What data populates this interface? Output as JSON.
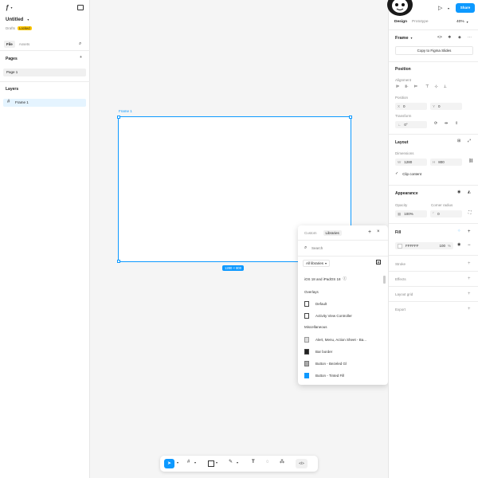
{
  "app": {
    "file_name": "Untitled",
    "team": "Drafts",
    "locked_badge": "Locked"
  },
  "left": {
    "tabs": [
      "File",
      "Assets"
    ],
    "pages_title": "Pages",
    "pages": [
      "Page 1"
    ],
    "layers_title": "Layers",
    "layers": [
      "Frame 1"
    ]
  },
  "canvas": {
    "frame_label": "Frame 1",
    "size_badge": "1280 × 800"
  },
  "library_popup": {
    "tabs": [
      "Custom",
      "Libraries"
    ],
    "search_placeholder": "Search",
    "filter_label": "All libraries",
    "group_title": "iOS 18 and iPadOS 18",
    "sections": [
      {
        "title": "Overlays",
        "items": [
          "Default",
          "Activity View Controller"
        ]
      },
      {
        "title": "Miscellaneous",
        "items": [
          "Alert, Menu, Action Sheet - Ba...",
          "Bar border",
          "Button - Bezeled Gl",
          "Button - Tinted Fill"
        ]
      }
    ]
  },
  "toolbar": {
    "code_label": "</>"
  },
  "right": {
    "tabs": [
      "Design",
      "Prototype"
    ],
    "zoom": "40%",
    "share_label": "Share",
    "frame_dropdown": "Frame",
    "copy_slides_button": "Copy to Figma Slides",
    "position_title": "Position",
    "alignment_label": "Alignment",
    "position_label": "Position",
    "x_label": "X",
    "x_value": "0",
    "y_label": "Y",
    "y_value": "0",
    "transform_label": "Transform",
    "rotation_value": "0°",
    "layout_title": "Layout",
    "dimensions_label": "Dimensions",
    "w_label": "W",
    "w_value": "1280",
    "h_label": "H",
    "h_value": "800",
    "clip_content_label": "Clip content",
    "appearance_title": "Appearance",
    "opacity_label": "Opacity",
    "opacity_value": "100%",
    "corner_radius_label": "Corner radius",
    "corner_radius_value": "0",
    "fill_title": "Fill",
    "fill_hex": "FFFFFF",
    "fill_opacity": "100",
    "fill_percent": "%",
    "stroke_title": "Stroke",
    "effects_title": "Effects",
    "layout_grid_title": "Layout grid",
    "export_title": "Export"
  },
  "help_label": "?",
  "colors": {
    "accent": "#0d99ff",
    "locked_badge_bg": "#ffc700",
    "selection": "#e5f4ff"
  }
}
